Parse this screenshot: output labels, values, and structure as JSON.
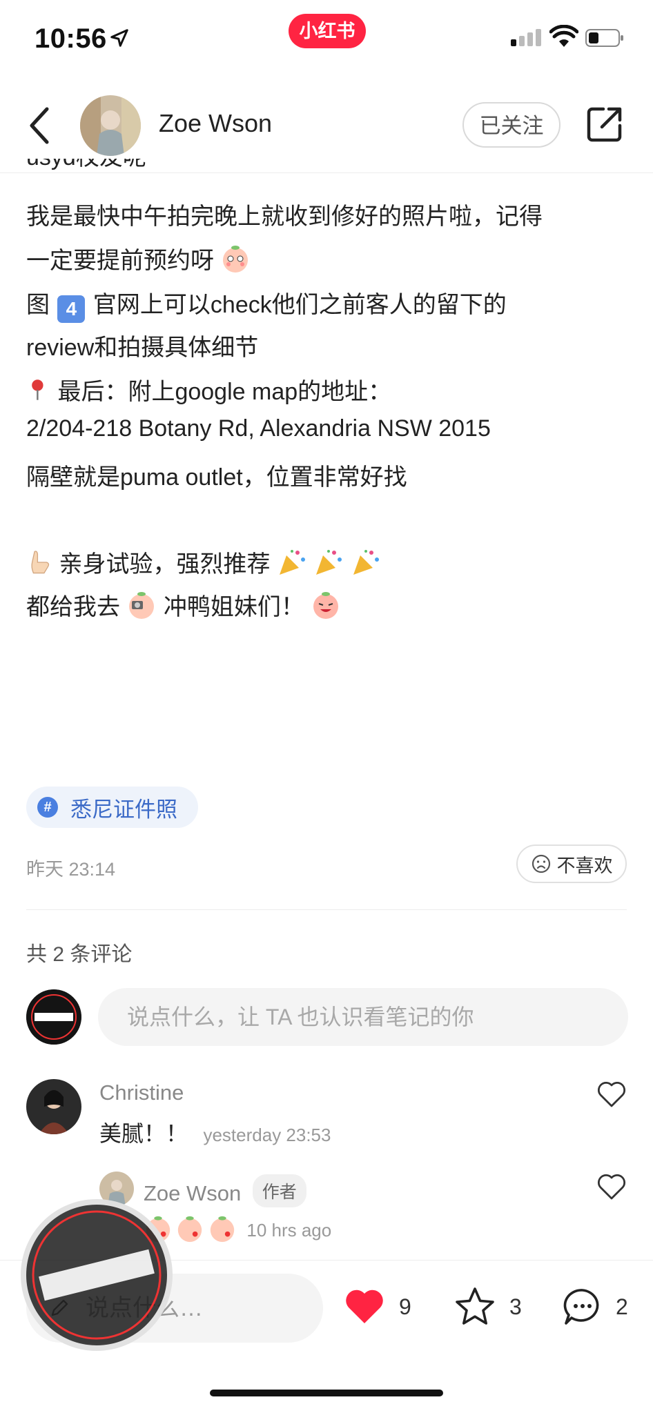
{
  "status_bar": {
    "time": "10:56",
    "app_badge": "小红书"
  },
  "header": {
    "username": "Zoe Wson",
    "follow_label": "已关注"
  },
  "post": {
    "partial_line": "usyd校友呢",
    "lines": [
      "我是最快中午拍完晚上就收到修好的照片啦，记得",
      "一定要提前预约呀",
      "官网上可以check他们之前客人的留下的",
      "review和拍摄具体细节",
      "最后：附上google map的地址：",
      "2/204-218 Botany Rd, Alexandria NSW 2015",
      "隔壁就是puma outlet，位置非常好找",
      "亲身试验，强烈推荐",
      "都给我去",
      "冲鸭姐妹们！"
    ],
    "fig_prefix": "图",
    "fig_number": "4"
  },
  "tag": {
    "label": "悉尼证件照",
    "icon": "#"
  },
  "meta": {
    "date": "昨天 23:14",
    "dislike_label": "不喜欢"
  },
  "comments": {
    "count_label": "共 2 条评论",
    "input_placeholder": "说点什么，让 TA 也认识看笔记的你",
    "items": [
      {
        "name": "Christine",
        "text": "美腻！！",
        "time": "yesterday 23:53"
      },
      {
        "name": "Zoe Wson",
        "badge": "作者",
        "time": "10 hrs ago"
      }
    ]
  },
  "bottom_bar": {
    "input_placeholder": "说点什么…",
    "likes": "9",
    "stars": "3",
    "comments": "2"
  },
  "colors": {
    "brand": "#ff2442",
    "tag": "#3b6ac7",
    "like": "#ff2442"
  }
}
